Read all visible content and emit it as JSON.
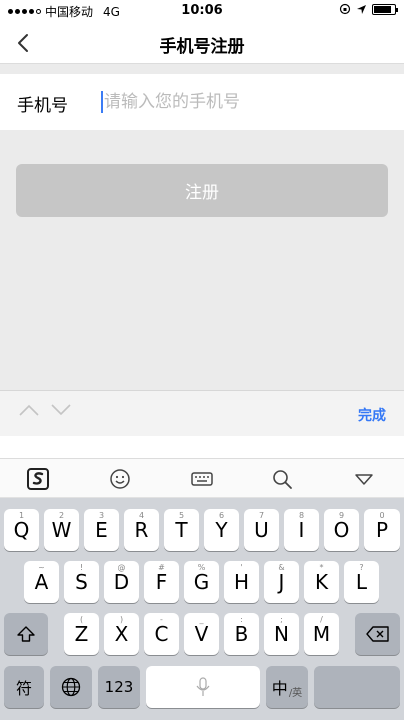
{
  "status_bar": {
    "carrier": "中国移动",
    "network": "4G",
    "time": "10:06",
    "battery_level": 0.85
  },
  "navbar": {
    "title": "手机号注册"
  },
  "form": {
    "phone_label": "手机号",
    "phone_placeholder": "请输入您的手机号",
    "phone_value": ""
  },
  "register_button": {
    "label": "注册"
  },
  "accessory": {
    "done_label": "完成"
  },
  "ime_toolbar": {
    "icons": [
      "sogou-logo-icon",
      "emoji-icon",
      "keyboard-icon",
      "search-icon",
      "collapse-icon"
    ]
  },
  "keyboard": {
    "row1": [
      "Q",
      "W",
      "E",
      "R",
      "T",
      "Y",
      "U",
      "I",
      "O",
      "P"
    ],
    "row1_sub": [
      "1",
      "2",
      "3",
      "4",
      "5",
      "6",
      "7",
      "8",
      "9",
      "0"
    ],
    "row2": [
      "A",
      "S",
      "D",
      "F",
      "G",
      "H",
      "J",
      "K",
      "L"
    ],
    "row2_sub": [
      "~",
      "!",
      "@",
      "#",
      "%",
      "'",
      "&",
      "*",
      "?"
    ],
    "row3": [
      "Z",
      "X",
      "C",
      "V",
      "B",
      "N",
      "M"
    ],
    "row3_sub": [
      "(",
      ")",
      "-",
      "_",
      ":",
      ";",
      "/"
    ],
    "symbol_label": "符",
    "numeric_label": "123",
    "chinese_label": "中",
    "english_label": "/英"
  }
}
